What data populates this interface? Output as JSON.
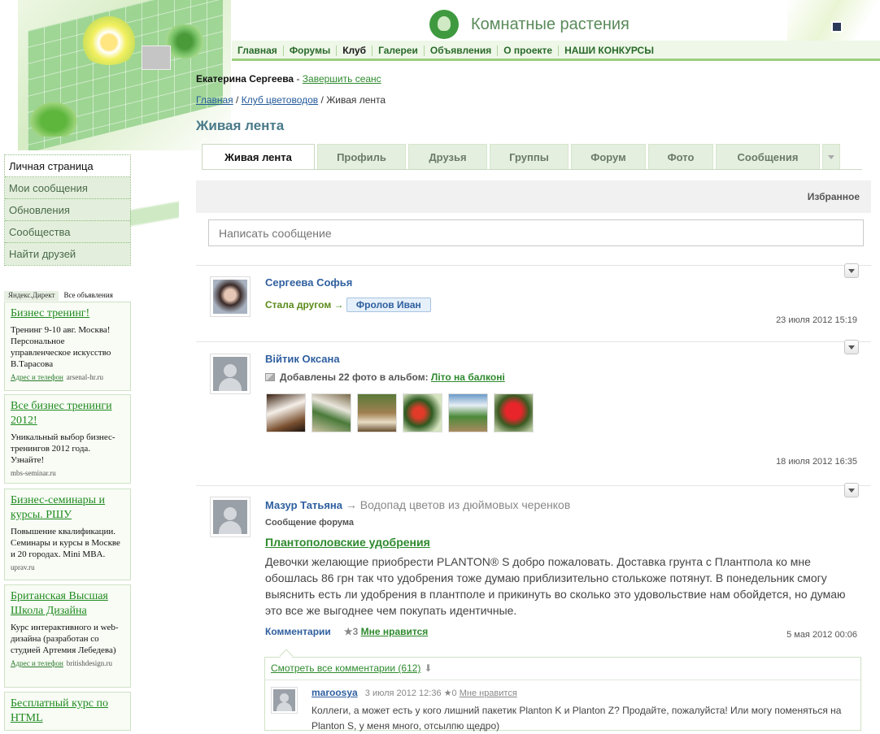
{
  "site": {
    "logo_text": "Комнатные растения"
  },
  "nav": {
    "items": [
      "Главная",
      "Форумы",
      "Клуб",
      "Галереи",
      "Объявления",
      "О проекте",
      "НАШИ КОНКУРСЫ"
    ],
    "active_index": 2
  },
  "session": {
    "user": "Екатерина Сергеева",
    "separator": " - ",
    "logout": "Завершить сеанс"
  },
  "breadcrumb": {
    "items": [
      "Главная",
      "Клуб цветоводов"
    ],
    "current": "Живая лента",
    "separator": " / "
  },
  "page_title": "Живая лента",
  "tabs": {
    "items": [
      "Живая лента",
      "Профиль",
      "Друзья",
      "Группы",
      "Форум",
      "Фото",
      "Сообщения"
    ],
    "active_index": 0
  },
  "left_menu": {
    "items": [
      "Личная страница",
      "Мои сообщения",
      "Обновления",
      "Сообщества",
      "Найти друзей"
    ],
    "active_index": 0
  },
  "ads": {
    "brand": "Яндекс.Директ",
    "all_label": "Все объявления",
    "items": [
      {
        "title": "Бизнес тренинг!",
        "text": "Тренинг 9-10 авг. Москва! Персональное управленческое искусство В.Тарасова",
        "link": "Адрес и телефон",
        "domain": "arsenal-hr.ru"
      },
      {
        "title": "Все бизнес тренинги 2012!",
        "text": "Уникальный выбор бизнес-тренингов 2012 года. Узнайте!",
        "link": "",
        "domain": "mbs-seminar.ru"
      },
      {
        "title": "Бизнес-семинары и курсы. РШУ",
        "text": "Повышение квалификации. Семинары и курсы в Москве и 20 городах. Mini MBA.",
        "link": "",
        "domain": "uprav.ru"
      },
      {
        "title": "Британская Высшая Школа Дизайна",
        "text": "Курс интерактивного и web-дизайна (разработан со студией Артемия Лебедева)",
        "link": "Адрес и телефон",
        "domain": "britishdesign.ru"
      },
      {
        "title": "Бесплатный курс по HTML",
        "text": "",
        "link": "",
        "domain": ""
      }
    ]
  },
  "favorites_label": "Избранное",
  "compose": {
    "placeholder": "Написать сообщение"
  },
  "feed": [
    {
      "author": "Сергеева Софья",
      "action": "Стала другом",
      "arrow": "→",
      "target": "Фролов Иван",
      "date": "23 июля 2012 15:19"
    },
    {
      "author": "Війтик Оксана",
      "action": "Добавлены 22 фото в альбом:",
      "album": "Літо на балконі",
      "date": "18 июля 2012 16:35"
    },
    {
      "author": "Мазур Татьяна",
      "arrow": "→",
      "topic": "Водопад цветов из дюймовых черенков",
      "label": "Сообщение форума",
      "title": "Плантополовские удобрения",
      "body": "Девочки  желающие приобрести PLANTON® S добро пожаловать. Доставка грунта с Плантпола ко мне обошлась 86 грн так что удобрения тоже думаю приблизительно столькоже потянут. В понедельник смогу выяснить есть ли удобрения в плантполе и прикинуть во сколько это удовольствие нам обойдется, но думаю это все же выгоднее чем покупать идентичные.",
      "comments_label": "Комментарии",
      "like_star": "★",
      "like_count": "3",
      "like_label": "Мне нравится",
      "date": "5 мая 2012 00:06",
      "view_all": "Смотреть все комментарии (612)",
      "view_all_arrow": "⬇",
      "comment": {
        "author": "maroosya",
        "date": "3 июля 2012 12:36",
        "star": "★",
        "count": "0",
        "dislike": "Мне нравится",
        "text": "Коллеги, а может есть у кого лишний пакетик Planton K и  Planton Z? Продайте, пожалуйста! Или могу поменяться на Planton S, у меня много, отсылпю щедро)"
      }
    }
  ]
}
